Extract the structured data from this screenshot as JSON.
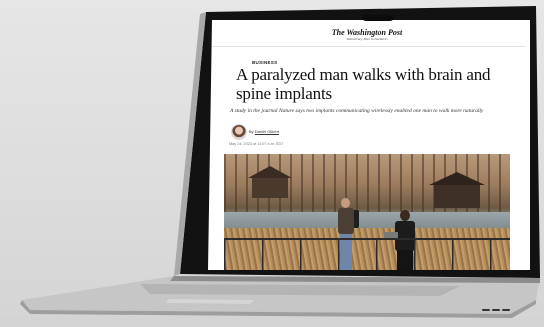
{
  "article": {
    "masthead": "The Washington Post",
    "tagline": "Democracy Dies in Darkness",
    "section": "BUSINESS",
    "headline": "A paralyzed man walks with brain and spine implants",
    "subheadline": "A study in the journal Nature says two implants communicating wirelessly enabled one man to walk more naturally",
    "byline_prefix": "By",
    "author": "Daniel Gilbert",
    "date": "May 24, 2023 at 11:07 a.m. EDT"
  },
  "colors": {
    "page_bg": "#ffffff",
    "laptop_body": "#c9c9c9",
    "bezel": "#111111",
    "backdrop": "#e0e0e0"
  },
  "icons": {
    "camera": "camera-notch-icon"
  }
}
